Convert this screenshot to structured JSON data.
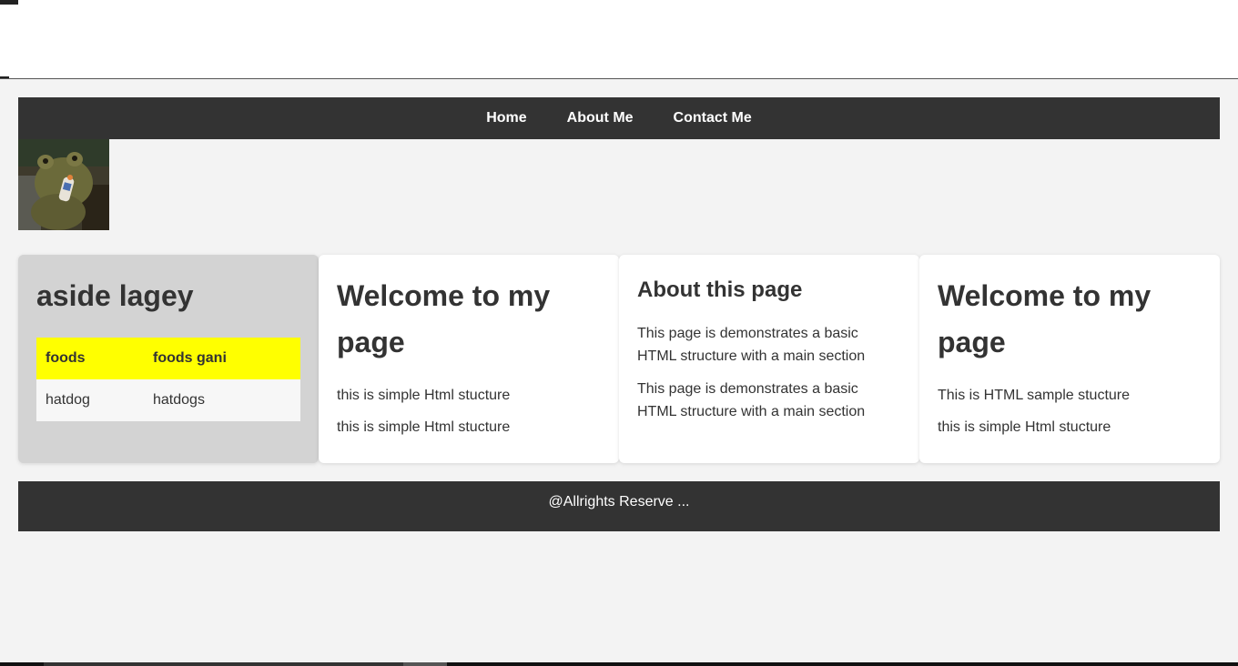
{
  "nav": {
    "items": [
      {
        "label": "Home"
      },
      {
        "label": "About Me"
      },
      {
        "label": "Contact Me"
      }
    ]
  },
  "aside": {
    "title": "aside lagey",
    "table": {
      "headers": [
        "foods",
        "foods gani"
      ],
      "rows": [
        [
          "hatdog",
          "hatdogs"
        ]
      ]
    }
  },
  "cards": [
    {
      "title": "Welcome to my page",
      "paragraphs": [
        "this is simple Html stucture",
        "this is simple Html stucture"
      ]
    },
    {
      "title": "About this page",
      "paragraphs": [
        "This page is demonstrates a basic HTML structure with a main section",
        "This page is demonstrates a basic HTML structure with a main section"
      ]
    },
    {
      "title": "Welcome to my page",
      "paragraphs": [
        "This is HTML sample stucture",
        "this is simple Html stucture"
      ]
    }
  ],
  "footer": {
    "text": "@Allrights Reserve ..."
  },
  "colors": {
    "nav_bg": "#333333",
    "page_bg": "#f3f3f3",
    "aside_bg": "#d3d3d3",
    "table_header_bg": "#ffff00"
  },
  "image": {
    "icon": "frog-photo"
  }
}
